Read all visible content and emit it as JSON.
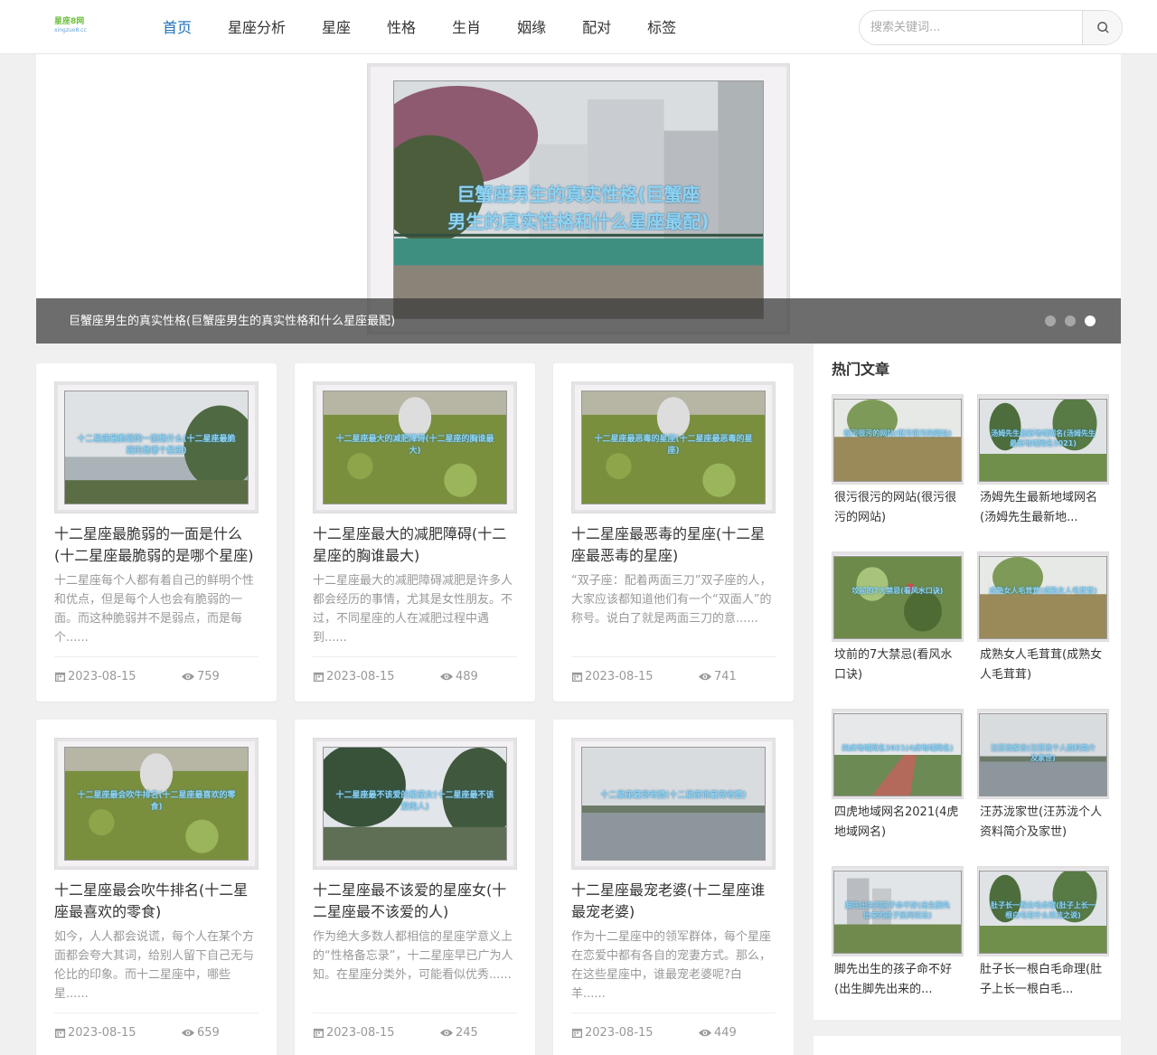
{
  "header": {
    "logo_cn": "星座8网",
    "logo_en": "xingzuo8.cc",
    "nav": [
      "首页",
      "星座分析",
      "星座",
      "性格",
      "生肖",
      "姻缘",
      "配对",
      "标签"
    ],
    "search_placeholder": "搜索关键词..."
  },
  "banner": {
    "overlay_line1": "巨蟹座男生的真实性格(巨蟹座",
    "overlay_line2": "男生的真实性格和什么星座最配)",
    "caption": "巨蟹座男生的真实性格(巨蟹座男生的真实性格和什么星座最配)",
    "slides": 3,
    "active_slide": 3
  },
  "articles": [
    {
      "title": "十二星座最脆弱的一面是什么(十二星座最脆弱的是哪个星座)",
      "overlay": "十二星座最脆弱的一面是什么(十二星座最脆弱的是哪个星座)",
      "desc": "十二星座每个人都有着自己的鲜明个性和优点，但是每个人也会有脆弱的一面。而这种脆弱并不是弱点，而是每个......",
      "date": "2023-08-15",
      "views": "759",
      "scene": "lake"
    },
    {
      "title": "十二星座最大的减肥障碍(十二星座的胸谁最大)",
      "overlay": "十二星座最大的减肥障碍(十二星座的胸谁最大)",
      "desc": "十二星座最大的减肥障碍减肥是许多人都会经历的事情，尤其是女性朋友。不过，不同星座的人在减肥过程中遇到......",
      "date": "2023-08-15",
      "views": "489",
      "scene": "meadow"
    },
    {
      "title": "十二星座最恶毒的星座(十二星座最恶毒的星座)",
      "overlay": "十二星座最恶毒的星座(十二星座最恶毒的星座)",
      "desc": "“双子座：配着两面三刀”双子座的人，大家应该都知道他们有一个“双面人”的称号。说白了就是两面三刀的意......",
      "date": "2023-08-15",
      "views": "741",
      "scene": "meadow"
    },
    {
      "title": "十二星座最会吹牛排名(十二星座最喜欢的零食)",
      "overlay": "十二星座最会吹牛排名(十二星座最喜欢的零食)",
      "desc": "如今，人人都会说谎，每个人在某个方面都会夸大其词，给别人留下自己无与伦比的印象。而十二星座中，哪些星......",
      "date": "2023-08-15",
      "views": "659",
      "scene": "meadow"
    },
    {
      "title": "十二星座最不该爱的星座女(十二星座最不该爱的人)",
      "overlay": "十二星座最不该爱的星座女(十二星座最不该爱的人)",
      "desc": "作为绝大多数人都相信的星座学意义上的“性格备忘录”，十二星座早已广为人知。在星座分类外，可能看似优秀......",
      "date": "2023-08-15",
      "views": "245",
      "scene": "trees"
    },
    {
      "title": "十二星座最宠老婆(十二星座谁最宠老婆)",
      "overlay": "十二星座最宠老婆(十二星座谁最宠老婆)",
      "desc": "作为十二星座中的领军群体，每个星座在恋爱中都有各自的宠妻方式。那么，在这些星座中，谁最宠老婆呢?白羊......",
      "date": "2023-08-15",
      "views": "449",
      "scene": "water"
    }
  ],
  "sidebar": {
    "title": "热门文章",
    "items": [
      {
        "title": "很污很污的网站(很污很污的网站)",
        "overlay": "很污很污的网站(很污很污的网站)",
        "scene": "field"
      },
      {
        "title": "汤姆先生最新地域网名(汤姆先生最新地...",
        "overlay": "汤姆先生最新地域网名(汤姆先生最新地域网名2021)",
        "scene": "park"
      },
      {
        "title": "坟前的7大禁忌(看风水口诀)",
        "overlay": "坟前的7大禁忌(看风水口诀)",
        "scene": "plant"
      },
      {
        "title": "成熟女人毛茸茸(成熟女人毛茸茸)",
        "overlay": "成熟女人毛茸茸(成熟女人毛茸茸)",
        "scene": "field"
      },
      {
        "title": "四虎地域网名2021(4虎地域网名)",
        "overlay": "四虎地域网名2021(4虎地域网名)",
        "scene": "road"
      },
      {
        "title": "汪苏泷家世(汪苏泷个人资料简介及家世)",
        "overlay": "汪苏泷家世(汪苏泷个人资料简介及家世)",
        "scene": "water"
      },
      {
        "title": "脚先出生的孩子命不好(出生脚先出来的...",
        "overlay": "脚先出生的孩子命不好(出生脚先出来的孩子民间说法)",
        "scene": "building"
      },
      {
        "title": "肚子长一根白毛命理(肚子上长一根白毛...",
        "overlay": "肚子长一根白毛命理(肚子上长一根白毛有什么说法之说)",
        "scene": "park"
      }
    ]
  },
  "colors": {
    "nav_active": "#1e6fb8",
    "muted_text": "#999999",
    "overlay_text": "#8fd3f0"
  }
}
